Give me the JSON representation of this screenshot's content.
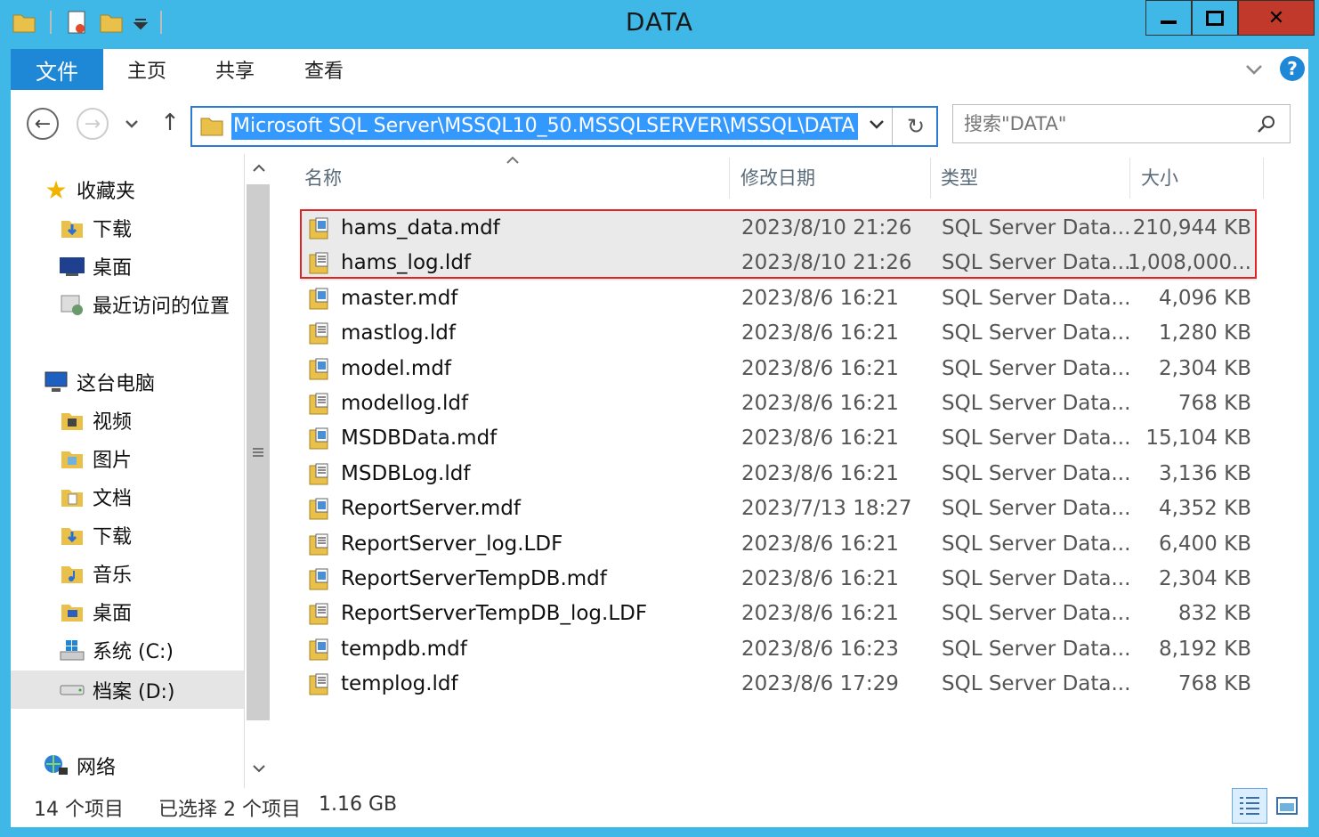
{
  "window": {
    "title": "DATA"
  },
  "ribbon": {
    "file": "文件",
    "home": "主页",
    "share": "共享",
    "view": "查看"
  },
  "address": {
    "path": "Microsoft SQL Server\\MSSQL10_50.MSSQLSERVER\\MSSQL\\DATA"
  },
  "search": {
    "placeholder": "搜索\"DATA\""
  },
  "nav": {
    "favorites": "收藏夹",
    "downloads": "下载",
    "desktop": "桌面",
    "recent": "最近访问的位置",
    "thispc": "这台电脑",
    "videos": "视频",
    "pictures": "图片",
    "documents": "文档",
    "downloads2": "下载",
    "music": "音乐",
    "desktop2": "桌面",
    "drive_c": "系统 (C:)",
    "drive_d": "档案 (D:)",
    "network": "网络"
  },
  "columns": {
    "name": "名称",
    "modified": "修改日期",
    "type": "类型",
    "size": "大小"
  },
  "files": [
    {
      "name": "hams_data.mdf",
      "modified": "2023/8/10 21:26",
      "type": "SQL Server Data...",
      "size": "210,944 KB"
    },
    {
      "name": "hams_log.ldf",
      "modified": "2023/8/10 21:26",
      "type": "SQL Server Data...",
      "size": "1,008,000..."
    },
    {
      "name": "master.mdf",
      "modified": "2023/8/6 16:21",
      "type": "SQL Server Data...",
      "size": "4,096 KB"
    },
    {
      "name": "mastlog.ldf",
      "modified": "2023/8/6 16:21",
      "type": "SQL Server Data...",
      "size": "1,280 KB"
    },
    {
      "name": "model.mdf",
      "modified": "2023/8/6 16:21",
      "type": "SQL Server Data...",
      "size": "2,304 KB"
    },
    {
      "name": "modellog.ldf",
      "modified": "2023/8/6 16:21",
      "type": "SQL Server Data...",
      "size": "768 KB"
    },
    {
      "name": "MSDBData.mdf",
      "modified": "2023/8/6 16:21",
      "type": "SQL Server Data...",
      "size": "15,104 KB"
    },
    {
      "name": "MSDBLog.ldf",
      "modified": "2023/8/6 16:21",
      "type": "SQL Server Data...",
      "size": "3,136 KB"
    },
    {
      "name": "ReportServer.mdf",
      "modified": "2023/7/13 18:27",
      "type": "SQL Server Data...",
      "size": "4,352 KB"
    },
    {
      "name": "ReportServer_log.LDF",
      "modified": "2023/8/6 16:21",
      "type": "SQL Server Data...",
      "size": "6,400 KB"
    },
    {
      "name": "ReportServerTempDB.mdf",
      "modified": "2023/8/6 16:21",
      "type": "SQL Server Data...",
      "size": "2,304 KB"
    },
    {
      "name": "ReportServerTempDB_log.LDF",
      "modified": "2023/8/6 16:21",
      "type": "SQL Server Data...",
      "size": "832 KB"
    },
    {
      "name": "tempdb.mdf",
      "modified": "2023/8/6 16:23",
      "type": "SQL Server Data...",
      "size": "8,192 KB"
    },
    {
      "name": "templog.ldf",
      "modified": "2023/8/6 17:29",
      "type": "SQL Server Data...",
      "size": "768 KB"
    }
  ],
  "status": {
    "count": "14 个项目",
    "selected": "已选择 2 个项目",
    "size": "1.16 GB"
  },
  "colors": {
    "accent": "#3fb8e8",
    "file_tab": "#1e88d6",
    "selection_border": "#e02424"
  }
}
